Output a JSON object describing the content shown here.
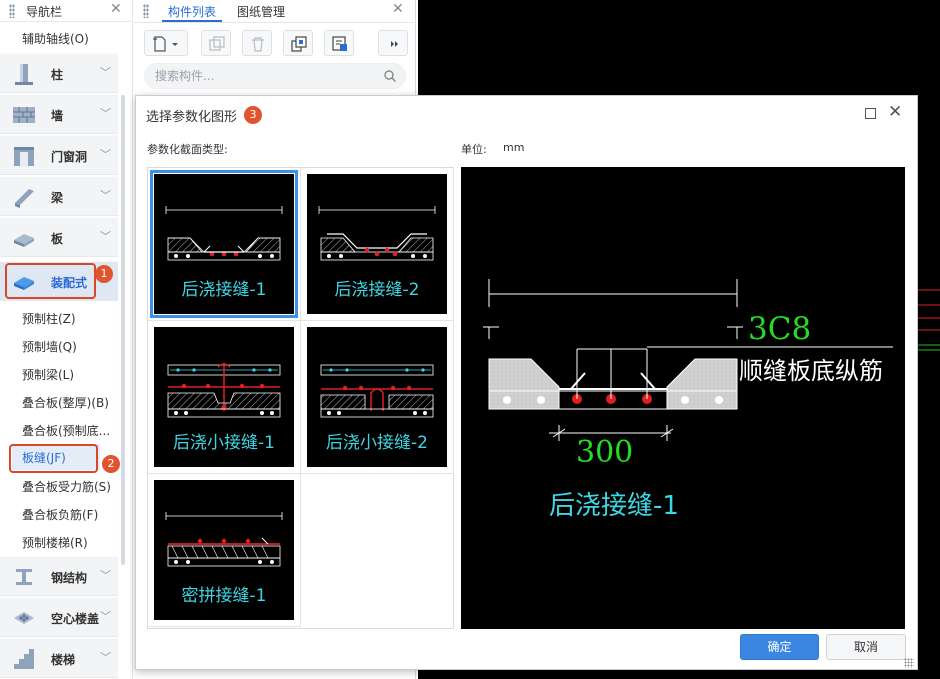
{
  "nav": {
    "title": "导航栏",
    "grid_aux": "辅助轴线(O)",
    "categories": [
      {
        "label": "柱",
        "icon": "column-icon"
      },
      {
        "label": "墙",
        "icon": "wall-icon"
      },
      {
        "label": "门窗洞",
        "icon": "door-window-icon"
      },
      {
        "label": "梁",
        "icon": "beam-icon"
      },
      {
        "label": "板",
        "icon": "slab-icon"
      },
      {
        "label": "装配式",
        "icon": "prefab-icon"
      },
      {
        "label": "钢结构",
        "icon": "steel-icon"
      },
      {
        "label": "空心楼盖",
        "icon": "hollow-floor-icon"
      },
      {
        "label": "楼梯",
        "icon": "stair-icon"
      }
    ],
    "sub_items": [
      "预制柱(Z)",
      "预制墙(Q)",
      "预制梁(L)",
      "叠合板(整厚)(B)",
      "叠合板(预制底...",
      "板缝(JF)",
      "叠合板受力筋(S)",
      "叠合板负筋(F)",
      "预制楼梯(R)"
    ],
    "markers": [
      "1",
      "2"
    ]
  },
  "panel": {
    "tabs": [
      "构件列表",
      "图纸管理"
    ],
    "search_placeholder": "搜索构件...",
    "toolbar_icons": [
      "new-icon",
      "copy-icon",
      "delete-icon",
      "layer-copy-icon",
      "filter-icon",
      "expand-icon"
    ]
  },
  "dialog": {
    "title": "选择参数化图形",
    "marker": "3",
    "section_label": "参数化截面类型:",
    "unit_label": "单位:",
    "unit_value": "mm",
    "shapes": [
      "后浇接缝-1",
      "后浇接缝-2",
      "后浇小接缝-1",
      "后浇小接缝-2",
      "密拼接缝-1"
    ],
    "selected_index": 0,
    "preview": {
      "rebar_spec": "3C8",
      "rebar_desc": "顺缝板底纵筋",
      "width": "300",
      "name": "后浇接缝-1"
    },
    "ok_label": "确定",
    "cancel_label": "取消"
  },
  "colors": {
    "accent": "#2a6bd6",
    "highlight": "#e0552f",
    "cad_caption": "#3fd6e4",
    "dimension": "#22dd22"
  }
}
